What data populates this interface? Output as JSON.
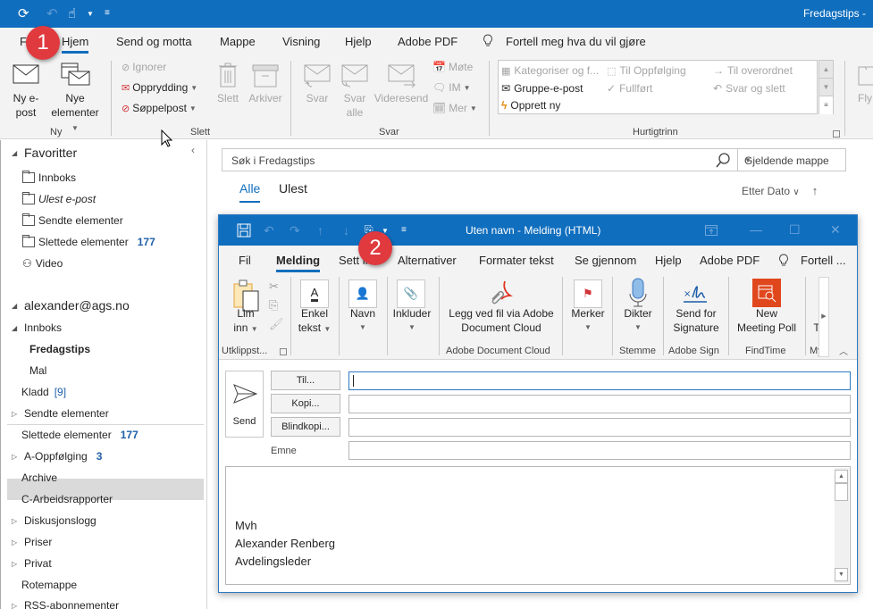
{
  "main_window": {
    "title": "Fredagstips -",
    "quick_access": [
      {
        "icon": "sync-icon"
      },
      {
        "icon": "undo-icon"
      },
      {
        "icon": "touch-mode-icon"
      },
      {
        "icon": "customize-quick-access-icon"
      }
    ],
    "tabs": [
      {
        "label": "Fil"
      },
      {
        "label": "Hjem",
        "active": true
      },
      {
        "label": "Send og motta"
      },
      {
        "label": "Mappe"
      },
      {
        "label": "Visning"
      },
      {
        "label": "Hjelp"
      },
      {
        "label": "Adobe PDF"
      }
    ],
    "tell_me": "Fortell meg hva du vil gjøre",
    "ribbon": {
      "ny": {
        "label": "Ny",
        "new_email": "Ny e-\npost",
        "new_email_l1": "Ny e-",
        "new_email_l2": "post",
        "new_items_l1": "Nye",
        "new_items_l2": "elementer"
      },
      "slett": {
        "label": "Slett",
        "ignore": "Ignorer",
        "cleanup": "Opprydding",
        "junk": "Søppelpost",
        "delete": "Slett",
        "archive": "Arkiver"
      },
      "svar": {
        "label": "Svar",
        "reply": "Svar",
        "reply_all_l1": "Svar",
        "reply_all_l2": "alle",
        "forward": "Videresend",
        "meeting": "Møte",
        "im": "IM",
        "more": "Mer"
      },
      "hurtigtrinn": {
        "label": "Hurtigtrinn",
        "items": [
          {
            "label": "Kategoriser og f...",
            "enabled": false,
            "icon": "categorize-icon"
          },
          {
            "label": "Til Oppfølging",
            "enabled": false,
            "icon": "followup-icon"
          },
          {
            "label": "Til overordnet",
            "enabled": false,
            "icon": "arrow-right-icon"
          },
          {
            "label": "Gruppe-e-post",
            "enabled": true,
            "icon": "envelope-icon"
          },
          {
            "label": "Fullført",
            "enabled": false,
            "icon": "checkmark-icon"
          },
          {
            "label": "Svar og slett",
            "enabled": false,
            "icon": "reply-delete-icon"
          },
          {
            "label": "Opprett ny",
            "enabled": true,
            "icon": "create-quickstep-icon"
          }
        ]
      },
      "move": {
        "label": "Fly"
      }
    }
  },
  "folder_pane": {
    "favorites_header": "Favoritter",
    "favorites": [
      {
        "label": "Innboks"
      },
      {
        "label": "Ulest e-post",
        "italic": true
      },
      {
        "label": "Sendte elementer"
      },
      {
        "label": "Slettede elementer",
        "count": "177"
      },
      {
        "label": "Video",
        "icon": "video-group-icon"
      }
    ],
    "account": "alexander@ags.no",
    "folders": [
      {
        "label": "Innboks",
        "expanded": true
      },
      {
        "label": "Fredagstips",
        "selected": true
      },
      {
        "label": "Mal"
      },
      {
        "label": "Kladd",
        "count": "[9]"
      },
      {
        "label": "Sendte elementer",
        "collapsed": true
      },
      {
        "label": "Slettede elementer",
        "count": "177"
      },
      {
        "label": "A-Oppfølging",
        "count": "3",
        "collapsed": true
      },
      {
        "label": "Archive"
      },
      {
        "label": "C-Arbeidsrapporter"
      },
      {
        "label": "Diskusjonslogg",
        "collapsed": true
      },
      {
        "label": "Priser",
        "collapsed": true
      },
      {
        "label": "Privat",
        "collapsed": true
      },
      {
        "label": "Rotemappe"
      },
      {
        "label": "RSS-abonnementer",
        "collapsed": true
      }
    ]
  },
  "message_list": {
    "search_placeholder": "Søk i Fredagstips",
    "search_scope": "Gjeldende mappe",
    "filters": [
      {
        "label": "Alle",
        "active": true
      },
      {
        "label": "Ulest"
      }
    ],
    "sort_label": "Etter Dato"
  },
  "compose": {
    "title": "Uten navn  -  Melding (HTML)",
    "tabs": [
      {
        "label": "Fil"
      },
      {
        "label": "Melding",
        "active": true
      },
      {
        "label": "Sett inn"
      },
      {
        "label": "Alternativer"
      },
      {
        "label": "Formater tekst"
      },
      {
        "label": "Se gjennom"
      },
      {
        "label": "Hjelp"
      },
      {
        "label": "Adobe PDF"
      }
    ],
    "tell_me": "Fortell ...",
    "ribbon": {
      "paste_l1": "Lim",
      "paste_l2": "inn",
      "clipboard_group": "Utklippst...",
      "plain_text_l1": "Enkel",
      "plain_text_l2": "tekst",
      "names": "Navn",
      "include": "Inkluder",
      "adobe_attach_l1": "Legg ved fil via Adobe",
      "adobe_attach_l2": "Document Cloud",
      "adobe_group": "Adobe Document Cloud",
      "tags": "Merker",
      "dictate": "Dikter",
      "voice_group": "Stemme",
      "send_sig_l1": "Send for",
      "send_sig_l2": "Signature",
      "adobe_sign_group": "Adobe Sign",
      "meeting_poll_l1": "New",
      "meeting_poll_l2": "Meeting Poll",
      "findtime_group": "FindTime",
      "templates_cut": "T",
      "my_group_cut": "My"
    },
    "send_label": "Send",
    "to_button": "Til...",
    "cc_button": "Kopi...",
    "bcc_button": "Blindkopi...",
    "subject_label": "Emne",
    "to_value": "",
    "cc_value": "",
    "bcc_value": "",
    "subject_value": "",
    "body_lines": [
      "Mvh",
      "Alexander Renberg",
      "Avdelingsleder"
    ]
  },
  "annotations": {
    "badge1": "1",
    "badge2": "2"
  }
}
